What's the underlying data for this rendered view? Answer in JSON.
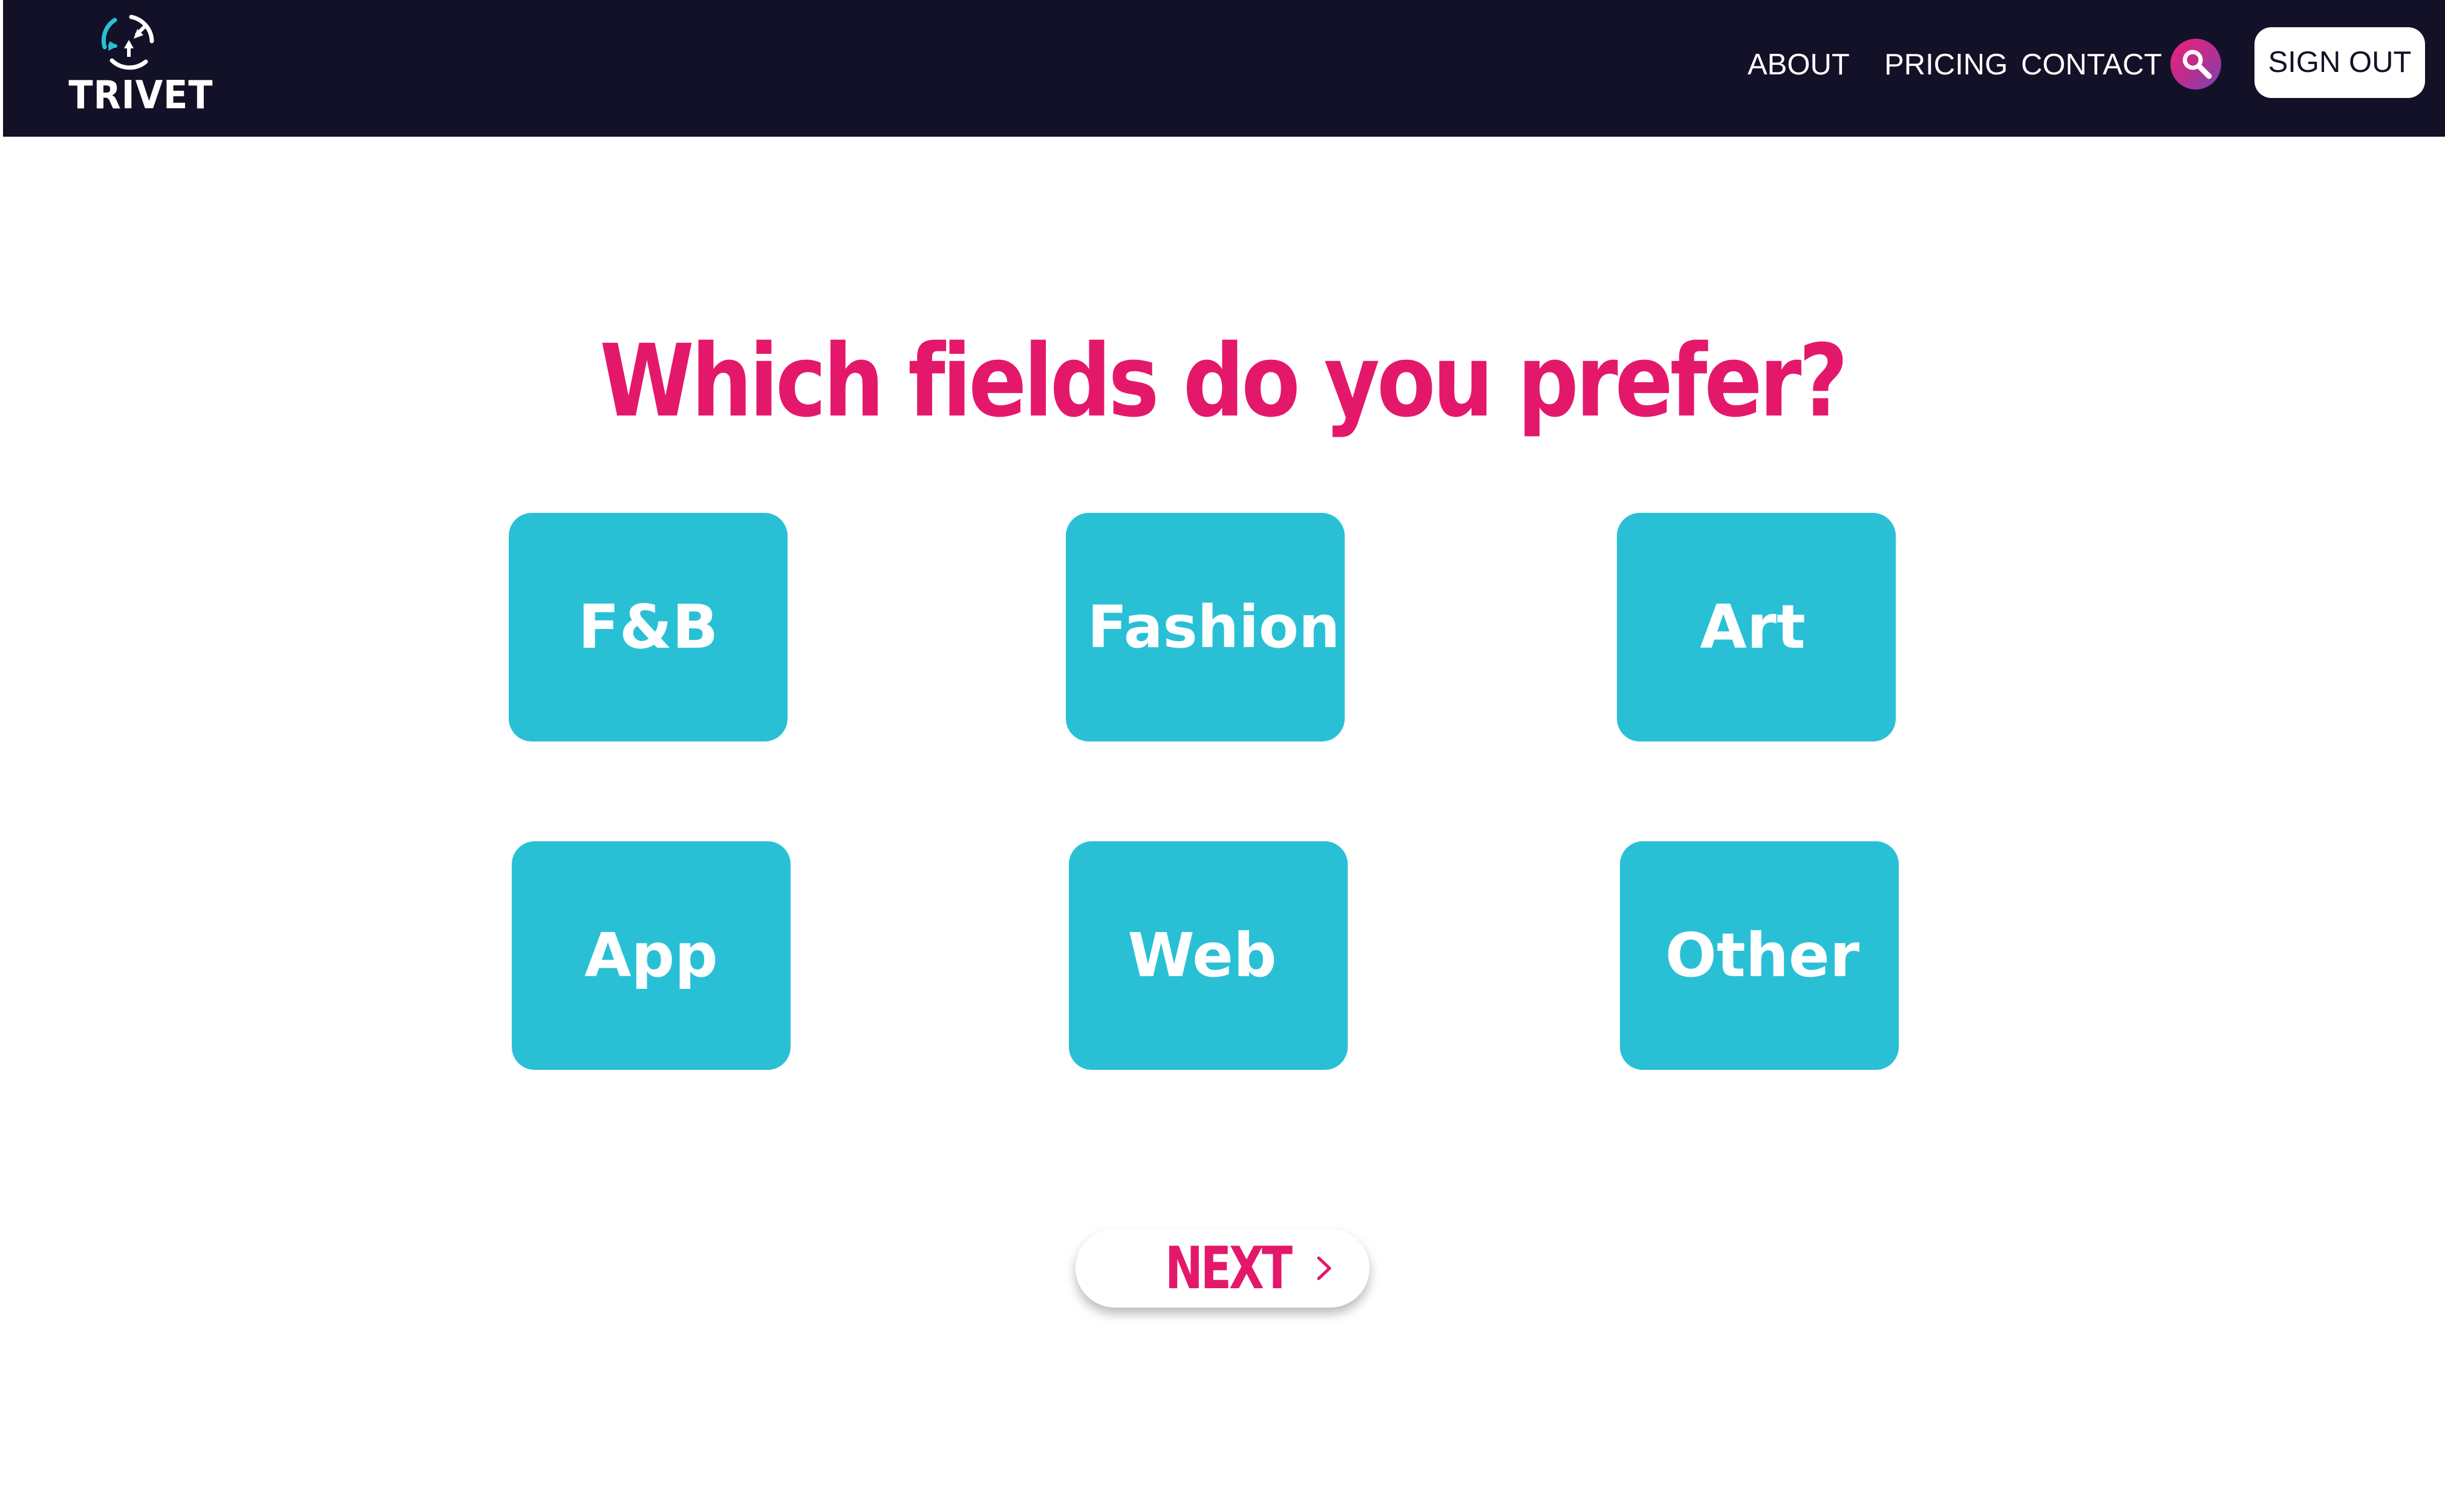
{
  "header": {
    "logo_text": "TRIVET",
    "nav": {
      "about": "ABOUT",
      "pricing": "PRICING",
      "contact": "CONTACT"
    },
    "search_icon": "search-icon",
    "sign_out_label": "SIGN OUT"
  },
  "main": {
    "heading": "Which fields do you prefer?",
    "options": [
      "F&B",
      "Fashion",
      "Art",
      "App",
      "Web",
      "Other"
    ],
    "next_label": "NEXT",
    "next_icon": "chevron-right-icon"
  },
  "colors": {
    "navbar_bg": "#121127",
    "accent_pink": "#e4186b",
    "tile_cyan": "#29c0d6",
    "logo_cyan": "#29c0d6",
    "white": "#ffffff"
  }
}
